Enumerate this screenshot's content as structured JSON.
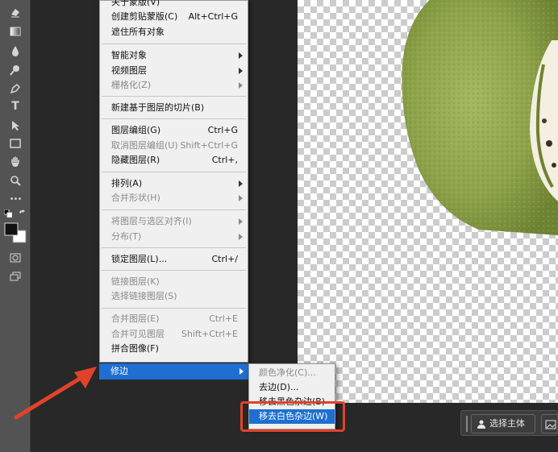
{
  "colors": {
    "accent": "#1e6fd1",
    "callout": "#e0432a",
    "menu_bg": "#f0f0f0",
    "workspace": "#282828",
    "toolbar": "#535353"
  },
  "toolbar": {
    "tools": [
      "eraser-icon",
      "gradient-icon",
      "blur-drop-icon",
      "dodge-icon",
      "pen-icon",
      "type-tool",
      "path-select-icon",
      "rectangle-icon",
      "hand-icon",
      "zoom-icon",
      "more-icon",
      "default-colors-icon",
      "swap-colors-icon",
      "color-swatches",
      "quick-mask-icon",
      "screen-mode-icon"
    ],
    "type_tool_label": "T",
    "more_label": "•••"
  },
  "menu": {
    "items": [
      {
        "label": "关于蒙版(V)",
        "disabled": false
      },
      {
        "label": "创建剪贴蒙版(C)",
        "shortcut": "Alt+Ctrl+G",
        "disabled": false
      },
      {
        "label": "遮住所有对象",
        "disabled": false
      },
      {
        "label": "智能对象",
        "submenu": true,
        "disabled": false
      },
      {
        "label": "视频图层",
        "submenu": true,
        "disabled": false
      },
      {
        "label": "栅格化(Z)",
        "submenu": true,
        "disabled": true
      },
      {
        "label": "新建基于图层的切片(B)",
        "disabled": false
      },
      {
        "label": "图层编组(G)",
        "shortcut": "Ctrl+G",
        "disabled": false
      },
      {
        "label": "取消图层编组(U)",
        "shortcut": "Shift+Ctrl+G",
        "disabled": true
      },
      {
        "label": "隐藏图层(R)",
        "shortcut": "Ctrl+,",
        "disabled": false
      },
      {
        "label": "排列(A)",
        "submenu": true,
        "disabled": false
      },
      {
        "label": "合并形状(H)",
        "submenu": true,
        "disabled": true
      },
      {
        "label": "将图层与选区对齐(I)",
        "submenu": true,
        "disabled": true
      },
      {
        "label": "分布(T)",
        "submenu": true,
        "disabled": true
      },
      {
        "label": "锁定图层(L)...",
        "shortcut": "Ctrl+/",
        "disabled": false
      },
      {
        "label": "链接图层(K)",
        "disabled": true
      },
      {
        "label": "选择链接图层(S)",
        "disabled": true
      },
      {
        "label": "合并图层(E)",
        "shortcut": "Ctrl+E",
        "disabled": true
      },
      {
        "label": "合并可见图层",
        "shortcut": "Shift+Ctrl+E",
        "disabled": true
      },
      {
        "label": "拼合图像(F)",
        "disabled": false
      }
    ],
    "highlighted": {
      "label": "修边"
    }
  },
  "submenu": {
    "items": [
      {
        "label": "颜色净化(C)...",
        "disabled": true
      },
      {
        "label": "去边(D)...",
        "disabled": false
      },
      {
        "label": "移去黑色杂边(B)",
        "disabled": false
      },
      {
        "label": "移去白色杂边(W)",
        "disabled": false,
        "highlighted": true
      }
    ]
  },
  "taskbar": {
    "select_subject": "选择主体"
  }
}
